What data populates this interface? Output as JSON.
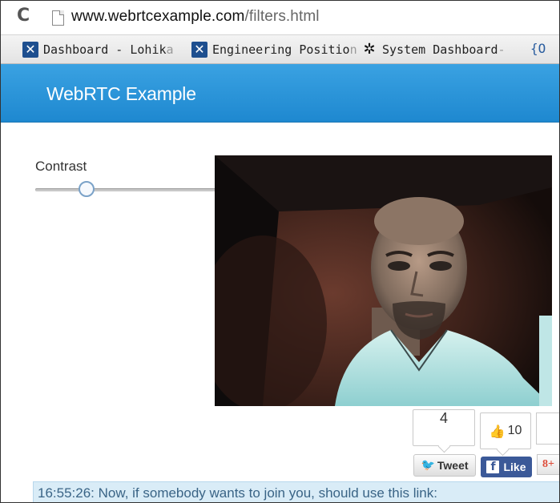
{
  "browser": {
    "url_host": "www.webrtcexample.com",
    "url_path": "/filters.html",
    "bookmarks": [
      {
        "label": "Dashboard - Lohik",
        "fade": "a",
        "icon": "jira-x-icon"
      },
      {
        "label": "Engineering Positio",
        "fade": "n",
        "icon": "jira-x-icon"
      },
      {
        "label": "System Dashboard",
        "fade": " -",
        "icon": "starburst-icon"
      }
    ],
    "bookmark_overflow": "{O"
  },
  "header": {
    "title": "WebRTC Example"
  },
  "controls": {
    "contrast_label": "Contrast",
    "contrast_value": 0.28
  },
  "social": {
    "tweet_count": "4",
    "tweet_label": "Tweet",
    "like_count": "10",
    "like_label": "Like",
    "gplus_label": "8+"
  },
  "log": {
    "line": "16:55:26: Now, if somebody wants to join you, should use this link:"
  },
  "colors": {
    "header_blue": "#2a95da",
    "facebook": "#3b5998",
    "log_bg": "#d9ecf7"
  }
}
